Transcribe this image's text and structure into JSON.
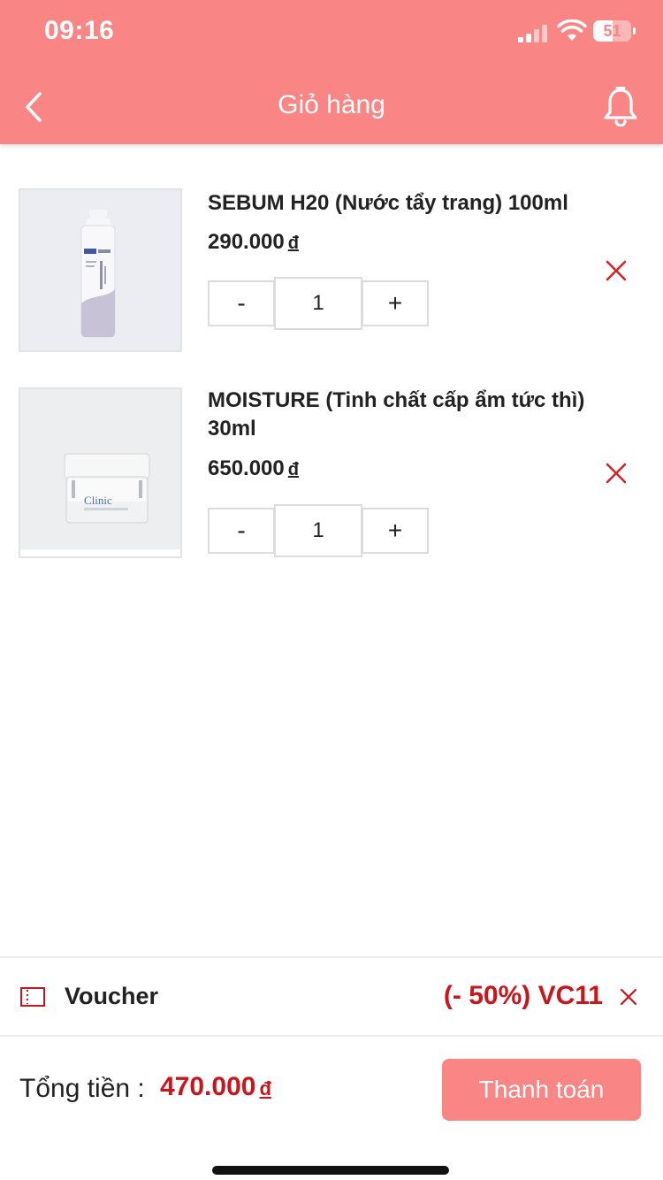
{
  "status_bar": {
    "time": "09:16",
    "battery": "51",
    "battery_level": 0.51
  },
  "header": {
    "title": "Giỏ hàng"
  },
  "cart": {
    "items": [
      {
        "name": "SEBUM H20 (Nước tẩy trang) 100ml",
        "price": "290.000",
        "currency": "đ",
        "quantity": "1",
        "minus_label": "-",
        "plus_label": "+"
      },
      {
        "name": "MOISTURE (Tinh chất cấp ẩm tức thì) 30ml",
        "price": "650.000",
        "currency": "đ",
        "quantity": "1",
        "minus_label": "-",
        "plus_label": "+"
      }
    ]
  },
  "voucher": {
    "label": "Voucher",
    "code": "(- 50%) VC11"
  },
  "total": {
    "label": "Tổng tiền :",
    "amount": "470.000",
    "currency": "đ"
  },
  "checkout": {
    "label": "Thanh toán"
  },
  "colors": {
    "primary": "#f98585",
    "accent_red": "#c8161d",
    "remove_red": "#d0262b"
  },
  "icons": [
    "back-chevron-icon",
    "bell-icon",
    "close-icon",
    "ticket-icon",
    "signal-icon",
    "wifi-icon",
    "battery-icon"
  ]
}
